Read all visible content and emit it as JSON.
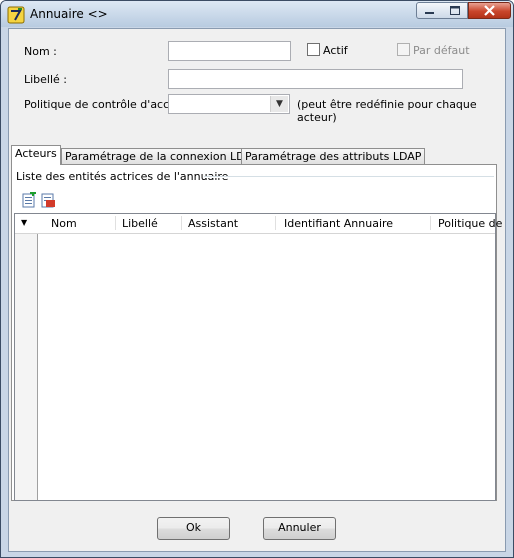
{
  "window": {
    "title": "Annuaire <>"
  },
  "form": {
    "nom_label": "Nom :",
    "nom_value": "",
    "actif_label": "Actif",
    "actif_checked": false,
    "par_defaut_label": "Par défaut",
    "par_defaut_checked": false,
    "libelle_label": "Libellé :",
    "libelle_value": "",
    "politique_label": "Politique de contrôle d'accès :",
    "politique_value": "",
    "politique_hint": "(peut être redéfinie pour chaque acteur)"
  },
  "tabs": [
    {
      "label": "Acteurs",
      "active": true
    },
    {
      "label": "Paramétrage de la connexion LDAP",
      "active": false
    },
    {
      "label": "Paramétrage des attributs LDAP",
      "active": false
    }
  ],
  "acteurs": {
    "group_title": "Liste des entités actrices de l'annuaire",
    "columns": [
      "Nom",
      "Libellé",
      "Assistant",
      "Identifiant Annuaire",
      "Politique de"
    ],
    "rows": []
  },
  "buttons": {
    "ok": "Ok",
    "annuler": "Annuler"
  },
  "colors": {
    "title_bg": "#c9d6e6",
    "close_btn": "#c9462c",
    "client_bg": "#f0f0f0"
  }
}
